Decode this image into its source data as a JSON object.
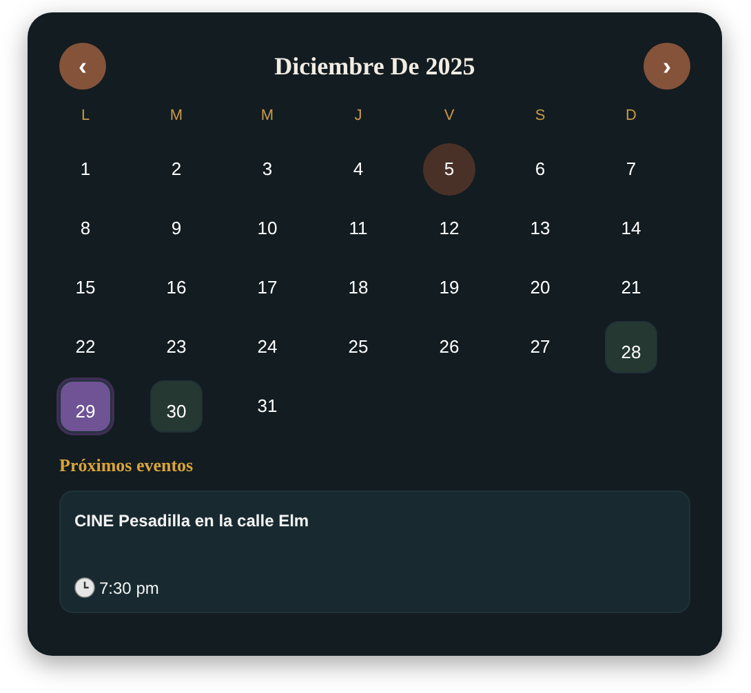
{
  "calendar": {
    "prev_button": "‹",
    "title": "Diciembre De 2025",
    "next_button": "›",
    "weekdays": [
      "L",
      "M",
      "M",
      "J",
      "V",
      "S",
      "D"
    ],
    "days": [
      {
        "label": "1",
        "kind": "plain",
        "selected": false
      },
      {
        "label": "2",
        "kind": "plain",
        "selected": false
      },
      {
        "label": "3",
        "kind": "plain",
        "selected": false
      },
      {
        "label": "4",
        "kind": "plain",
        "selected": false
      },
      {
        "label": "5",
        "kind": "today",
        "selected": false
      },
      {
        "label": "6",
        "kind": "plain",
        "selected": false
      },
      {
        "label": "7",
        "kind": "plain",
        "selected": false
      },
      {
        "label": "8",
        "kind": "plain",
        "selected": false
      },
      {
        "label": "9",
        "kind": "plain",
        "selected": false
      },
      {
        "label": "10",
        "kind": "plain",
        "selected": false
      },
      {
        "label": "11",
        "kind": "plain",
        "selected": false
      },
      {
        "label": "12",
        "kind": "plain",
        "selected": false
      },
      {
        "label": "13",
        "kind": "plain",
        "selected": false
      },
      {
        "label": "14",
        "kind": "plain",
        "selected": false
      },
      {
        "label": "15",
        "kind": "plain",
        "selected": false
      },
      {
        "label": "16",
        "kind": "plain",
        "selected": false
      },
      {
        "label": "17",
        "kind": "plain",
        "selected": false
      },
      {
        "label": "18",
        "kind": "plain",
        "selected": false
      },
      {
        "label": "19",
        "kind": "plain",
        "selected": false
      },
      {
        "label": "20",
        "kind": "plain",
        "selected": false
      },
      {
        "label": "21",
        "kind": "plain",
        "selected": false
      },
      {
        "label": "22",
        "kind": "plain",
        "selected": false
      },
      {
        "label": "23",
        "kind": "plain",
        "selected": false
      },
      {
        "label": "24",
        "kind": "plain",
        "selected": false
      },
      {
        "label": "25",
        "kind": "plain",
        "selected": false
      },
      {
        "label": "26",
        "kind": "plain",
        "selected": false
      },
      {
        "label": "27",
        "kind": "plain",
        "selected": false
      },
      {
        "label": "28",
        "kind": "event",
        "selected": false
      },
      {
        "label": "29",
        "kind": "event",
        "selected": true
      },
      {
        "label": "30",
        "kind": "event",
        "selected": false
      },
      {
        "label": "31",
        "kind": "plain",
        "selected": false
      }
    ]
  },
  "upcoming": {
    "heading": "Próximos eventos",
    "events": [
      {
        "title": "CINE Pesadilla en la calle Elm",
        "time": "7:30 pm"
      }
    ]
  }
}
